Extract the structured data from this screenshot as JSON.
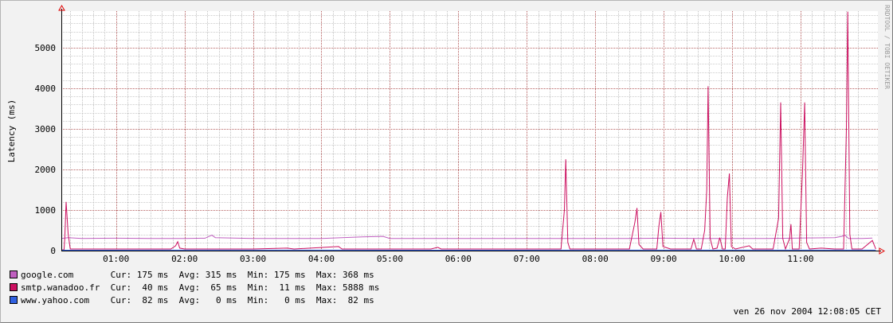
{
  "chart_data": {
    "type": "line",
    "ylabel": "Latency (ms)",
    "ylim": [
      0,
      5900
    ],
    "xlim_hours": [
      0.2,
      12.13
    ],
    "yticks": [
      0,
      1000,
      2000,
      3000,
      4000,
      5000
    ],
    "xtick_labels": [
      "01:00",
      "02:00",
      "03:00",
      "04:00",
      "05:00",
      "06:00",
      "07:00",
      "08:00",
      "09:00",
      "10:00",
      "11:00"
    ],
    "xtick_hours": [
      1,
      2,
      3,
      4,
      5,
      6,
      7,
      8,
      9,
      10,
      11
    ],
    "grid": true,
    "series": [
      {
        "name": "google.com",
        "color": "#c060c0",
        "points": [
          [
            0.2,
            300
          ],
          [
            0.3,
            320
          ],
          [
            0.5,
            300
          ],
          [
            1.0,
            305
          ],
          [
            1.5,
            300
          ],
          [
            2.0,
            300
          ],
          [
            2.3,
            305
          ],
          [
            2.4,
            380
          ],
          [
            2.45,
            320
          ],
          [
            3.0,
            300
          ],
          [
            3.5,
            300
          ],
          [
            4.0,
            300
          ],
          [
            4.6,
            340
          ],
          [
            4.9,
            350
          ],
          [
            5.0,
            300
          ],
          [
            5.5,
            300
          ],
          [
            6.0,
            300
          ],
          [
            6.5,
            300
          ],
          [
            7.0,
            300
          ],
          [
            7.5,
            300
          ],
          [
            8.0,
            300
          ],
          [
            8.5,
            300
          ],
          [
            9.0,
            305
          ],
          [
            9.5,
            300
          ],
          [
            10.0,
            300
          ],
          [
            10.5,
            300
          ],
          [
            11.0,
            310
          ],
          [
            11.5,
            320
          ],
          [
            11.6,
            350
          ],
          [
            11.65,
            380
          ],
          [
            11.7,
            300
          ],
          [
            11.9,
            300
          ],
          [
            12.05,
            310
          ]
        ]
      },
      {
        "name": "smtp.wanadoo.fr",
        "color": "#cc1060",
        "points": [
          [
            0.2,
            20
          ],
          [
            0.24,
            20
          ],
          [
            0.25,
            300
          ],
          [
            0.27,
            1200
          ],
          [
            0.3,
            400
          ],
          [
            0.33,
            40
          ],
          [
            1.0,
            40
          ],
          [
            1.8,
            40
          ],
          [
            1.87,
            120
          ],
          [
            1.9,
            220
          ],
          [
            1.93,
            60
          ],
          [
            2.0,
            40
          ],
          [
            3.0,
            40
          ],
          [
            3.5,
            60
          ],
          [
            3.6,
            40
          ],
          [
            4.25,
            100
          ],
          [
            4.3,
            40
          ],
          [
            5.0,
            40
          ],
          [
            5.6,
            40
          ],
          [
            5.7,
            80
          ],
          [
            5.75,
            40
          ],
          [
            6.0,
            40
          ],
          [
            7.0,
            40
          ],
          [
            7.5,
            40
          ],
          [
            7.55,
            1000
          ],
          [
            7.57,
            2250
          ],
          [
            7.6,
            200
          ],
          [
            7.63,
            40
          ],
          [
            8.0,
            40
          ],
          [
            8.5,
            40
          ],
          [
            8.58,
            700
          ],
          [
            8.61,
            1050
          ],
          [
            8.64,
            150
          ],
          [
            8.7,
            40
          ],
          [
            8.9,
            40
          ],
          [
            8.93,
            600
          ],
          [
            8.96,
            950
          ],
          [
            8.99,
            100
          ],
          [
            9.1,
            40
          ],
          [
            9.4,
            40
          ],
          [
            9.44,
            280
          ],
          [
            9.48,
            40
          ],
          [
            9.55,
            40
          ],
          [
            9.6,
            500
          ],
          [
            9.63,
            1500
          ],
          [
            9.65,
            4050
          ],
          [
            9.68,
            300
          ],
          [
            9.72,
            40
          ],
          [
            9.78,
            60
          ],
          [
            9.82,
            320
          ],
          [
            9.86,
            40
          ],
          [
            9.9,
            40
          ],
          [
            9.93,
            1300
          ],
          [
            9.96,
            1900
          ],
          [
            9.99,
            100
          ],
          [
            10.05,
            40
          ],
          [
            10.25,
            120
          ],
          [
            10.3,
            40
          ],
          [
            10.6,
            40
          ],
          [
            10.68,
            800
          ],
          [
            10.71,
            3650
          ],
          [
            10.74,
            300
          ],
          [
            10.78,
            40
          ],
          [
            10.84,
            300
          ],
          [
            10.86,
            650
          ],
          [
            10.88,
            40
          ],
          [
            10.98,
            40
          ],
          [
            11.03,
            2000
          ],
          [
            11.06,
            3650
          ],
          [
            11.09,
            200
          ],
          [
            11.13,
            40
          ],
          [
            11.3,
            60
          ],
          [
            11.5,
            40
          ],
          [
            11.63,
            40
          ],
          [
            11.67,
            3000
          ],
          [
            11.69,
            5888
          ],
          [
            11.72,
            400
          ],
          [
            11.75,
            40
          ],
          [
            11.9,
            40
          ],
          [
            12.05,
            250
          ],
          [
            12.1,
            40
          ]
        ]
      },
      {
        "name": "www.yahoo.com",
        "color": "#3060e0",
        "points": [
          [
            0.2,
            10
          ],
          [
            2.0,
            12
          ],
          [
            4.0,
            12
          ],
          [
            6.0,
            10
          ],
          [
            8.0,
            12
          ],
          [
            10.0,
            12
          ],
          [
            12.1,
            12
          ]
        ]
      }
    ]
  },
  "legend": [
    {
      "label": "google.com      ",
      "cur": "175 ms",
      "avg": "315 ms",
      "min": "175 ms",
      "max": "368 ms",
      "color": "#c060c0"
    },
    {
      "label": "smtp.wanadoo.fr ",
      "cur": " 40 ms",
      "avg": " 65 ms",
      "min": " 11 ms",
      "max": "5888 ms",
      "color": "#cc1060"
    },
    {
      "label": "www.yahoo.com   ",
      "cur": " 82 ms",
      "avg": "  0 ms",
      "min": "  0 ms",
      "max": " 82 ms",
      "color": "#3060e0"
    }
  ],
  "stat_labels": {
    "cur": "Cur:",
    "avg": "Avg:",
    "min": "Min:",
    "max": "Max:"
  },
  "timestamp": "ven 26 nov 2004 12:08:05 CET",
  "watermark": "RRDTOOL / TOBI OETIKER"
}
